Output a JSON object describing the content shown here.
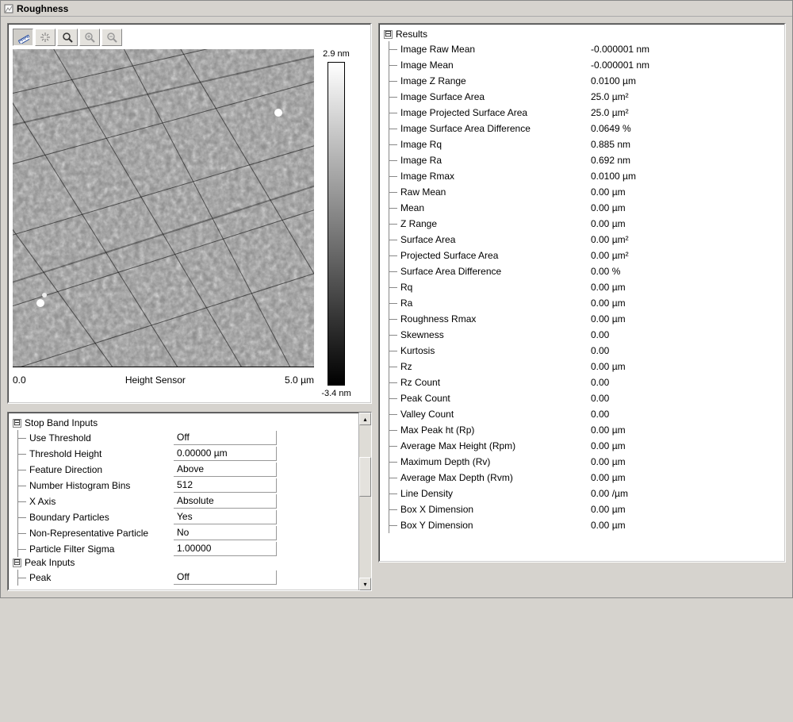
{
  "window": {
    "title": "Roughness"
  },
  "toolbar": {
    "ruler_icon": "ruler-icon",
    "sparkle_icon": "sparkle-icon",
    "zoom_icon": "zoom-icon",
    "zoom_in_icon": "zoom-in-icon",
    "zoom_out_icon": "zoom-out-icon"
  },
  "image": {
    "axis_min": "0.0",
    "axis_label": "Height Sensor",
    "axis_max": "5.0 µm",
    "scale_max": "2.9 nm",
    "scale_min": "-3.4 nm"
  },
  "stopband": {
    "title": "Stop Band Inputs",
    "rows": [
      {
        "label": "Use Threshold",
        "value": "Off"
      },
      {
        "label": "Threshold Height",
        "value": "0.00000 µm"
      },
      {
        "label": "Feature Direction",
        "value": "Above"
      },
      {
        "label": "Number Histogram Bins",
        "value": "512"
      },
      {
        "label": "X Axis",
        "value": "Absolute"
      },
      {
        "label": "Boundary Particles",
        "value": "Yes"
      },
      {
        "label": "Non-Representative Particle",
        "value": "No"
      },
      {
        "label": "Particle Filter Sigma",
        "value": "1.00000"
      }
    ]
  },
  "peak": {
    "title": "Peak Inputs",
    "rows": [
      {
        "label": "Peak",
        "value": "Off"
      }
    ]
  },
  "results": {
    "title": "Results",
    "rows": [
      {
        "label": "Image Raw Mean",
        "value": "-0.000001 nm"
      },
      {
        "label": "Image Mean",
        "value": "-0.000001 nm"
      },
      {
        "label": "Image Z Range",
        "value": "0.0100 µm"
      },
      {
        "label": "Image Surface Area",
        "value": "25.0 µm²"
      },
      {
        "label": "Image Projected Surface Area",
        "value": "25.0 µm²"
      },
      {
        "label": "Image Surface Area Difference",
        "value": "0.0649 %"
      },
      {
        "label": "Image Rq",
        "value": "0.885 nm"
      },
      {
        "label": "Image Ra",
        "value": "0.692 nm"
      },
      {
        "label": "Image Rmax",
        "value": "0.0100 µm"
      },
      {
        "label": "Raw Mean",
        "value": "0.00 µm"
      },
      {
        "label": "Mean",
        "value": "0.00 µm"
      },
      {
        "label": "Z Range",
        "value": "0.00 µm"
      },
      {
        "label": "Surface Area",
        "value": "0.00 µm²"
      },
      {
        "label": "Projected Surface Area",
        "value": "0.00 µm²"
      },
      {
        "label": "Surface Area Difference",
        "value": "0.00 %"
      },
      {
        "label": "Rq",
        "value": "0.00 µm"
      },
      {
        "label": "Ra",
        "value": "0.00 µm"
      },
      {
        "label": "Roughness Rmax",
        "value": "0.00 µm"
      },
      {
        "label": "Skewness",
        "value": "0.00"
      },
      {
        "label": "Kurtosis",
        "value": "0.00"
      },
      {
        "label": "Rz",
        "value": "0.00 µm"
      },
      {
        "label": "Rz Count",
        "value": "0.00"
      },
      {
        "label": "Peak Count",
        "value": "0.00"
      },
      {
        "label": "Valley Count",
        "value": "0.00"
      },
      {
        "label": "Max Peak ht (Rp)",
        "value": "0.00 µm"
      },
      {
        "label": "Average Max Height (Rpm)",
        "value": "0.00 µm"
      },
      {
        "label": "Maximum Depth (Rv)",
        "value": "0.00 µm"
      },
      {
        "label": "Average Max Depth (Rvm)",
        "value": "0.00 µm"
      },
      {
        "label": "Line Density",
        "value": "0.00 /µm"
      },
      {
        "label": "Box X Dimension",
        "value": "0.00 µm"
      },
      {
        "label": "Box Y Dimension",
        "value": "0.00 µm"
      }
    ]
  }
}
